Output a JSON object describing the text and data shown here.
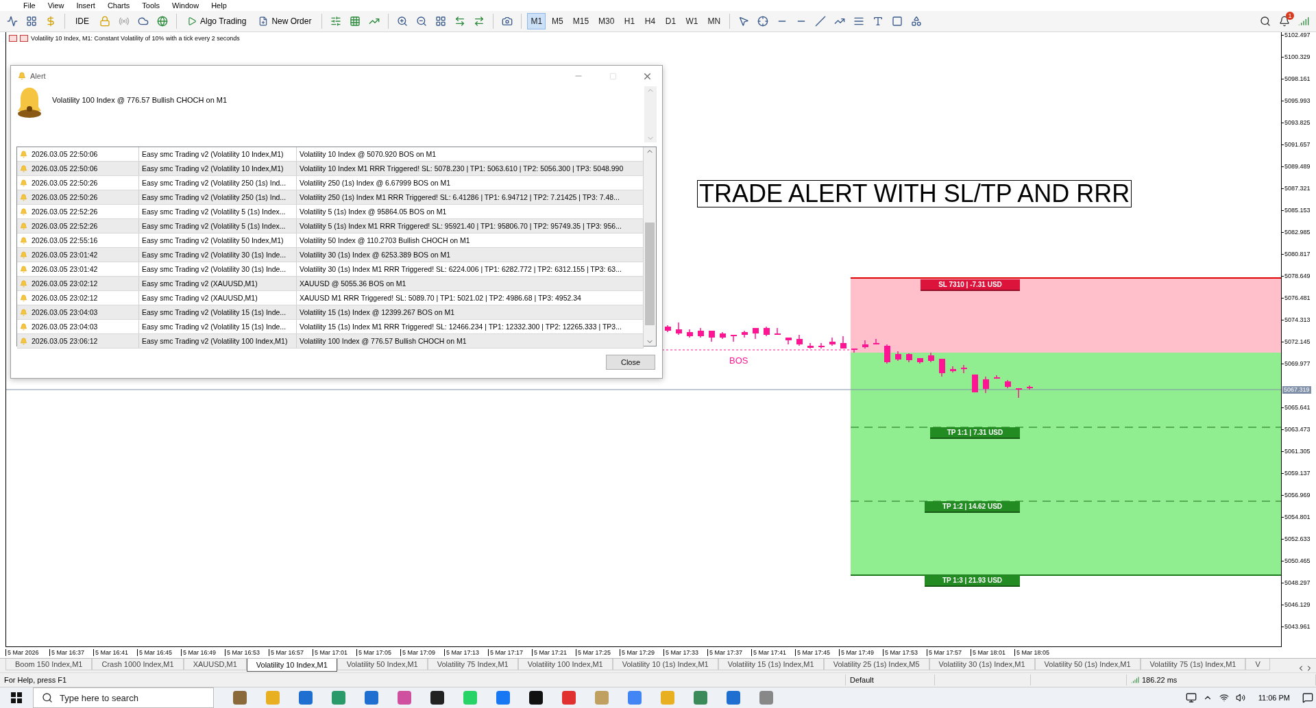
{
  "menu": [
    "File",
    "View",
    "Insert",
    "Charts",
    "Tools",
    "Window",
    "Help"
  ],
  "toolbar": {
    "ide": "IDE",
    "algo_trading": "Algo Trading",
    "new_order": "New Order",
    "notification_count": "1",
    "timeframes": [
      {
        "label": "M1",
        "selected": true
      },
      {
        "label": "M5",
        "selected": false
      },
      {
        "label": "M15",
        "selected": false
      },
      {
        "label": "M30",
        "selected": false
      },
      {
        "label": "H1",
        "selected": false
      },
      {
        "label": "H4",
        "selected": false
      },
      {
        "label": "D1",
        "selected": false
      },
      {
        "label": "W1",
        "selected": false
      },
      {
        "label": "MN",
        "selected": false
      }
    ]
  },
  "chart": {
    "header": "Volatility 10 Index, M1:  Constant Volatility of 10% with a tick every 2 seconds",
    "trade_alert_text": "TRADE ALERT WITH SL/TP AND RRR",
    "bos_label": "BOS",
    "zones": [
      {
        "kind": "sl",
        "label": "SL 7310 | -7.31 USD"
      },
      {
        "kind": "tp",
        "label": "TP 1:1 | 7.31 USD"
      },
      {
        "kind": "tp",
        "label": "TP 1:2 | 14.62 USD"
      },
      {
        "kind": "tp",
        "label": "TP 1:3 | 21.93 USD"
      }
    ],
    "price_axis": [
      "5102.497",
      "5100.329",
      "5098.161",
      "5095.993",
      "5093.825",
      "5091.657",
      "5089.489",
      "5087.321",
      "5085.153",
      "5082.985",
      "5080.817",
      "5078.649",
      "5076.481",
      "5074.313",
      "5072.145",
      "5069.977",
      "5065.641",
      "5063.473",
      "5061.305",
      "5059.137",
      "5056.969",
      "5054.801",
      "5052.633",
      "5050.465",
      "5048.297",
      "5046.129",
      "5043.961"
    ],
    "current_price": "5067.319",
    "time_axis": [
      "5 Mar 2026",
      "5 Mar 16:37",
      "5 Mar 16:41",
      "5 Mar 16:45",
      "5 Mar 16:49",
      "5 Mar 16:53",
      "5 Mar 16:57",
      "5 Mar 17:01",
      "5 Mar 17:05",
      "5 Mar 17:09",
      "5 Mar 17:13",
      "5 Mar 17:17",
      "5 Mar 17:21",
      "5 Mar 17:25",
      "5 Mar 17:29",
      "5 Mar 17:33",
      "5 Mar 17:37",
      "5 Mar 17:41",
      "5 Mar 17:45",
      "5 Mar 17:49",
      "5 Mar 17:53",
      "5 Mar 17:57",
      "5 Mar 18:01",
      "5 Mar 18:05"
    ]
  },
  "alert_dialog": {
    "title": "Alert",
    "message": "Volatility 100 Index @ 776.57 Bullish CHOCH on M1",
    "close_button": "Close",
    "rows": [
      {
        "time": "2026.03.05 22:50:06",
        "expert": "Easy smc Trading v2 (Volatility 10 Index,M1)",
        "message": "Volatility 10 Index @ 5070.920 BOS on M1"
      },
      {
        "time": "2026.03.05 22:50:06",
        "expert": "Easy smc Trading v2 (Volatility 10 Index,M1)",
        "message": "Volatility 10 Index M1 RRR Triggered! SL: 5078.230 | TP1: 5063.610 | TP2: 5056.300 | TP3: 5048.990"
      },
      {
        "time": "2026.03.05 22:50:26",
        "expert": "Easy smc Trading v2 (Volatility 250 (1s) Ind...",
        "message": "Volatility 250 (1s) Index @ 6.67999 BOS on M1"
      },
      {
        "time": "2026.03.05 22:50:26",
        "expert": "Easy smc Trading v2 (Volatility 250 (1s) Ind...",
        "message": "Volatility 250 (1s) Index M1 RRR Triggered! SL: 6.41286 | TP1: 6.94712 | TP2: 7.21425 | TP3: 7.48..."
      },
      {
        "time": "2026.03.05 22:52:26",
        "expert": "Easy smc Trading v2 (Volatility 5 (1s) Index...",
        "message": "Volatility 5 (1s) Index @ 95864.05 BOS on M1"
      },
      {
        "time": "2026.03.05 22:52:26",
        "expert": "Easy smc Trading v2 (Volatility 5 (1s) Index...",
        "message": "Volatility 5 (1s) Index M1 RRR Triggered! SL: 95921.40 | TP1: 95806.70 | TP2: 95749.35 | TP3: 956..."
      },
      {
        "time": "2026.03.05 22:55:16",
        "expert": "Easy smc Trading v2 (Volatility 50 Index,M1)",
        "message": "Volatility 50 Index @ 110.2703 Bullish CHOCH on M1"
      },
      {
        "time": "2026.03.05 23:01:42",
        "expert": "Easy smc Trading v2 (Volatility 30 (1s) Inde...",
        "message": "Volatility 30 (1s) Index @ 6253.389 BOS on M1"
      },
      {
        "time": "2026.03.05 23:01:42",
        "expert": "Easy smc Trading v2 (Volatility 30 (1s) Inde...",
        "message": "Volatility 30 (1s) Index M1 RRR Triggered! SL: 6224.006 | TP1: 6282.772 | TP2: 6312.155 | TP3: 63..."
      },
      {
        "time": "2026.03.05 23:02:12",
        "expert": "Easy smc Trading v2 (XAUUSD,M1)",
        "message": "XAUUSD @ 5055.36 BOS on M1"
      },
      {
        "time": "2026.03.05 23:02:12",
        "expert": "Easy smc Trading v2 (XAUUSD,M1)",
        "message": "XAUUSD M1 RRR Triggered! SL: 5089.70 | TP1: 5021.02 | TP2: 4986.68 | TP3: 4952.34"
      },
      {
        "time": "2026.03.05 23:04:03",
        "expert": "Easy smc Trading v2 (Volatility 15 (1s) Inde...",
        "message": "Volatility 15 (1s) Index @ 12399.267 BOS on M1"
      },
      {
        "time": "2026.03.05 23:04:03",
        "expert": "Easy smc Trading v2 (Volatility 15 (1s) Inde...",
        "message": "Volatility 15 (1s) Index M1 RRR Triggered! SL: 12466.234 | TP1: 12332.300 | TP2: 12265.333 | TP3..."
      },
      {
        "time": "2026.03.05 23:06:12",
        "expert": "Easy smc Trading v2 (Volatility 100 Index,M1)",
        "message": "Volatility 100 Index @ 776.57 Bullish CHOCH on M1"
      }
    ]
  },
  "symbol_tabs": [
    {
      "label": "Boom 150 Index,M1",
      "selected": false
    },
    {
      "label": "Crash 1000 Index,M1",
      "selected": false
    },
    {
      "label": "XAUUSD,M1",
      "selected": false
    },
    {
      "label": "Volatility 10 Index,M1",
      "selected": true
    },
    {
      "label": "Volatility 50 Index,M1",
      "selected": false
    },
    {
      "label": "Volatility 75 Index,M1",
      "selected": false
    },
    {
      "label": "Volatility 100 Index,M1",
      "selected": false
    },
    {
      "label": "Volatility 10 (1s) Index,M1",
      "selected": false
    },
    {
      "label": "Volatility 15 (1s) Index,M1",
      "selected": false
    },
    {
      "label": "Volatility 25 (1s) Index,M5",
      "selected": false
    },
    {
      "label": "Volatility 30 (1s) Index,M1",
      "selected": false
    },
    {
      "label": "Volatility 50 (1s) Index,M1",
      "selected": false
    },
    {
      "label": "Volatility 75 (1s) Index,M1",
      "selected": false
    },
    {
      "label": "V",
      "selected": false
    }
  ],
  "status_bar": {
    "help": "For Help, press F1",
    "profile": "Default",
    "ping": "186.22 ms"
  },
  "taskbar": {
    "search_placeholder": "Type here to search",
    "time": "11:06 PM"
  }
}
